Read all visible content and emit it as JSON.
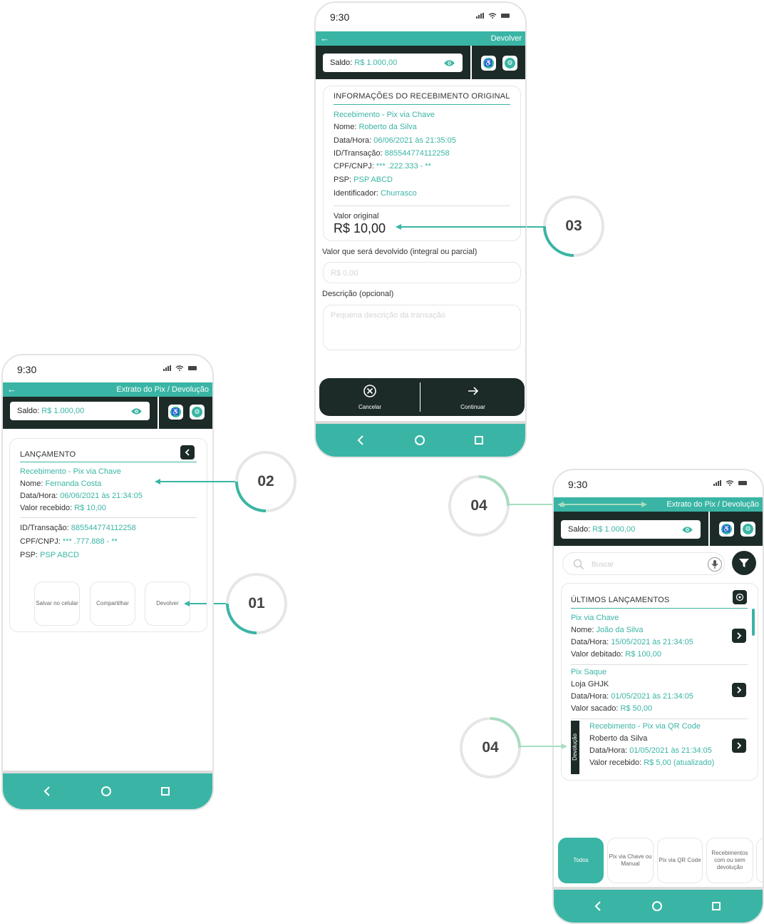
{
  "colors": {
    "accent": "#3ab5a5",
    "dark": "#1d2b28",
    "ring_gray": "#e6e6e6",
    "arrow_light": "#a8dcc0"
  },
  "status": {
    "time": "9:30"
  },
  "callouts": {
    "c01": "01",
    "c02": "02",
    "c03": "03",
    "c04a": "04",
    "c04b": "04"
  },
  "phone1": {
    "title": "Extrato do Pix / Devolução",
    "saldo_label": "Saldo:",
    "saldo_value": "R$ 1.000,00",
    "section_title": "LANÇAMENTO",
    "type": "Recebimento - Pix via Chave",
    "nome_label": "Nome:",
    "nome": "Fernanda Costa",
    "data_label": "Data/Hora:",
    "data": "06/06/2021 às 21:34:05",
    "valor_label": "Valor recebido:",
    "valor": "R$ 10,00",
    "id_label": "ID/Transação:",
    "id": "885544774112258",
    "cpf_label": "CPF/CNPJ:",
    "cpf": "*** .777.888 - **",
    "psp_label": "PSP:",
    "psp": "PSP ABCD",
    "btn_salvar": "Salvar no celular",
    "btn_compartilhar": "Compartilhar",
    "btn_devolver": "Devolver"
  },
  "phone2": {
    "title": "Devolver",
    "saldo_label": "Saldo:",
    "saldo_value": "R$ 1.000,00",
    "section_title": "INFORMAÇÕES DO RECEBIMENTO ORIGINAL",
    "type": "Recebimento - Pix via Chave",
    "nome_label": "Nome:",
    "nome": "Roberto da Silva",
    "data_label": "Data/Hora:",
    "data": "06/06/2021 às 21:35:05",
    "id_label": "ID/Transação:",
    "id": "885544774112258",
    "cpf_label": "CPF/CNPJ:",
    "cpf": "*** .222.333 - **",
    "psp_label": "PSP:",
    "psp": "PSP ABCD",
    "ident_label": "Identificador:",
    "ident": "Churrasco",
    "valor_orig_label": "Valor original",
    "valor_orig": "R$ 10,00",
    "devolver_label": "Valor que será devolvido (integral ou parcial)",
    "devolver_placeholder": "R$ 0,00",
    "desc_label": "Descrição (opcional)",
    "desc_placeholder": "Pequena descrição da transação",
    "cancelar": "Cancelar",
    "continuar": "Continuar"
  },
  "phone3": {
    "title": "Extrato do Pix / Devolução",
    "saldo_label": "Saldo:",
    "saldo_value": "R$ 1.000,00",
    "search_placeholder": "Buscar",
    "section_title": "ÚLTIMOS LANÇAMENTOS",
    "entries": [
      {
        "type": "Pix via Chave",
        "l1_label": "Nome:",
        "l1": "João da Silva",
        "l2_label": "Data/Hora:",
        "l2": "15/05/2021 às 21:34:05",
        "l3_label": "Valor debitado:",
        "l3": "R$ 100,00"
      },
      {
        "type": "Pix Saque",
        "l1_label": "Loja GHJK",
        "l1": "",
        "l2_label": "Data/Hora:",
        "l2": "01/05/2021 às 21:34:05",
        "l3_label": "Valor sacado:",
        "l3": "R$ 50,00"
      },
      {
        "type": "Recebimento - Pix via QR Code",
        "l1_label": "Roberto da Silva",
        "l1": "",
        "l2_label": "Data/Hora:",
        "l2": "01/05/2021 às 21:34:05",
        "l3_label": "Valor recebido:",
        "l3": "R$ 5,00 (atualizado)",
        "tag": "Devolução"
      }
    ],
    "filters": [
      "Todos",
      "Pix via Chave ou Manual",
      "Pix via QR Code",
      "Recebimentos com ou sem devolução"
    ]
  }
}
